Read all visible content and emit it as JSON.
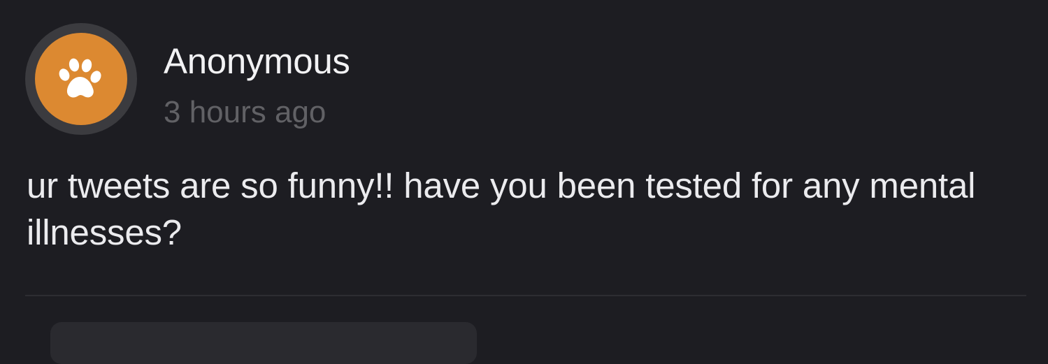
{
  "post": {
    "author": "Anonymous",
    "timestamp": "3 hours ago",
    "message": "ur tweets are so funny!! have you been tested for any mental illnesses?",
    "avatar_icon": "paw-icon",
    "avatar_color": "#dc8931"
  },
  "reply": {
    "placeholder": ""
  }
}
